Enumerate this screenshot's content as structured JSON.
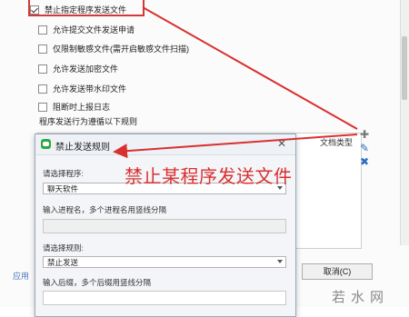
{
  "settings": {
    "options": [
      {
        "label": "禁止指定程序发送文件",
        "checked": true
      },
      {
        "label": "允许提交文件发送申请",
        "checked": false
      },
      {
        "label": "仅限制敏感文件(需开启敏感文件扫描)",
        "checked": false
      },
      {
        "label": "允许发送加密文件",
        "checked": false
      },
      {
        "label": "允许发送带水印文件",
        "checked": false
      },
      {
        "label": "阻断时上报日志",
        "checked": false
      }
    ],
    "rule_caption": "程序发送行为遵循以下规则",
    "doc_type_header": "文档类型",
    "bottom_left_text": "应用",
    "cancel_label": "取消(C)"
  },
  "icons": {
    "add": "plus-icon",
    "edit": "pencil-icon",
    "delete": "cross-icon",
    "close": "close-icon"
  },
  "dialog": {
    "title": "禁止发送规则",
    "program_label": "请选择程序:",
    "program_value": "聊天软件",
    "process_label": "输入进程名，多个进程名用竖线分隔",
    "process_value": "",
    "rule_label": "请选择规则:",
    "rule_value": "禁止发送",
    "suffix_label": "输入后缀，多个后缀用竖线分隔",
    "suffix_value": ""
  },
  "annotation": {
    "text": "禁止某程序发送文件",
    "color": "#d93030"
  },
  "watermark": "若水网"
}
